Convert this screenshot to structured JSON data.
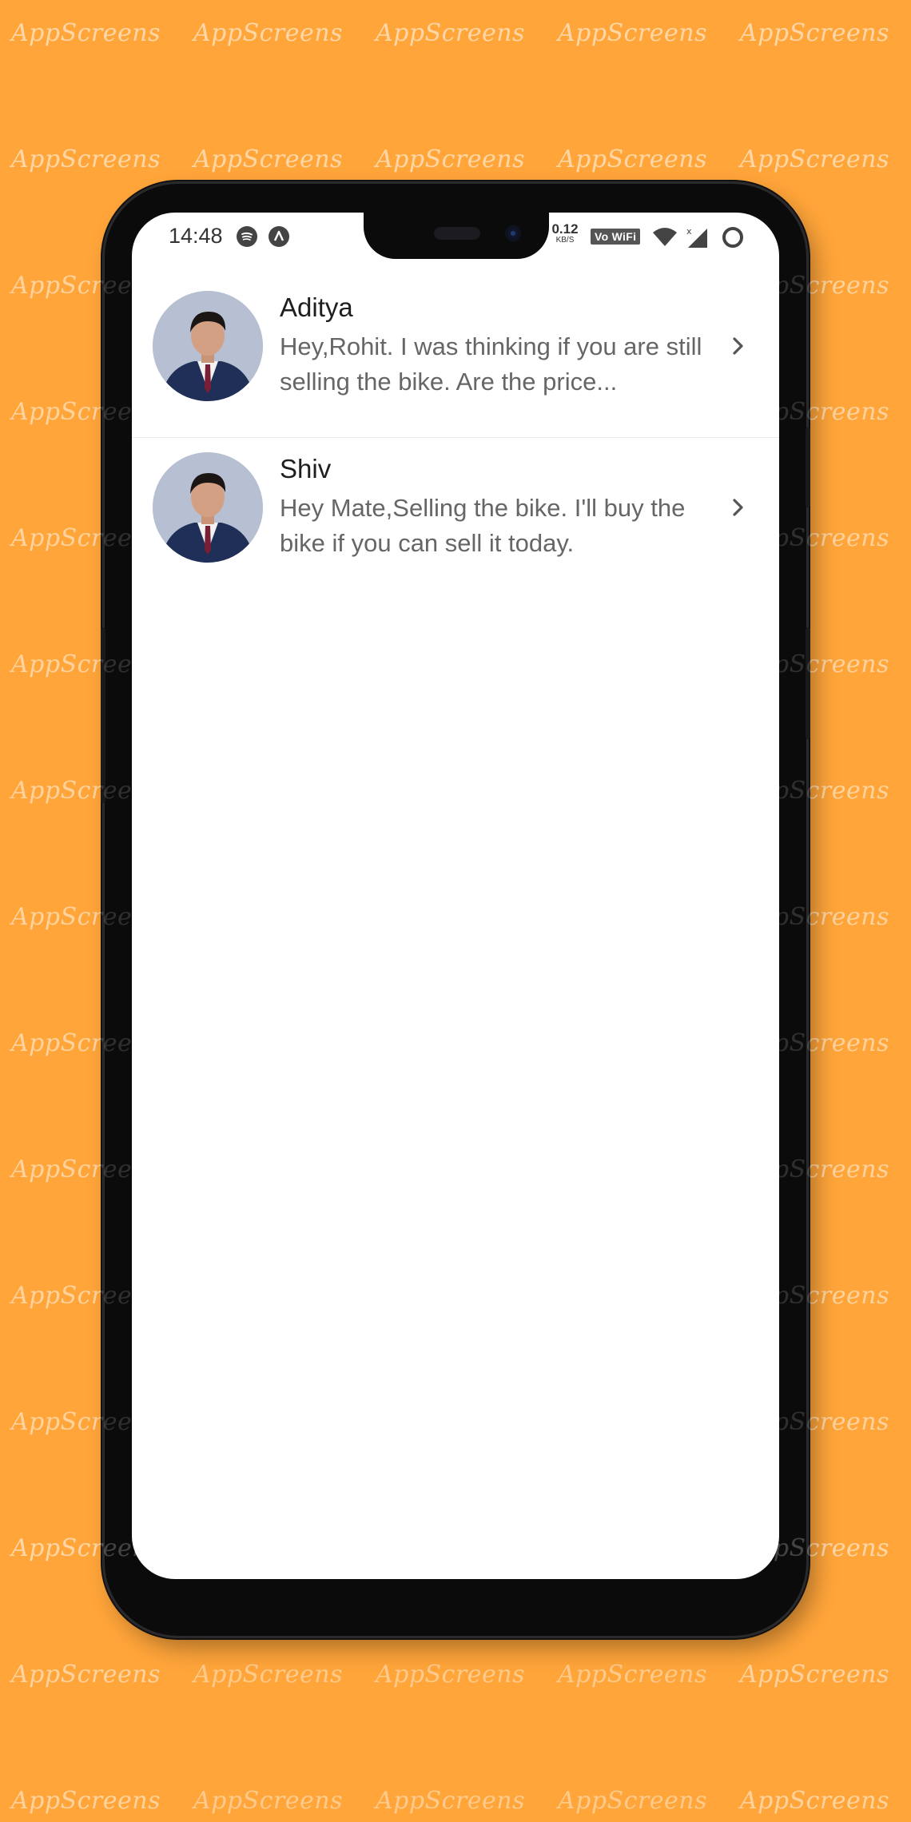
{
  "watermark": {
    "text": "AppScreens"
  },
  "status_bar": {
    "time": "14:48",
    "notification_icons": [
      "spotify-icon",
      "app-notification-icon"
    ],
    "net_speed_value": "0.12",
    "net_speed_unit": "KB/S",
    "vowifi_label": "Vo WiFi",
    "system_icons": [
      "wifi-icon",
      "signal-icon",
      "battery-ring-icon"
    ]
  },
  "chats": [
    {
      "name": "Aditya",
      "preview": "Hey,Rohit. I was thinking if you are still selling the bike. Are the price..."
    },
    {
      "name": "Shiv",
      "preview": "Hey Mate,Selling the bike. I'll buy the bike if you can sell it today."
    }
  ],
  "colors": {
    "background": "#FFA53A",
    "screen": "#FFFFFF",
    "name_text": "#1E1E1E",
    "preview_text": "#666666"
  }
}
